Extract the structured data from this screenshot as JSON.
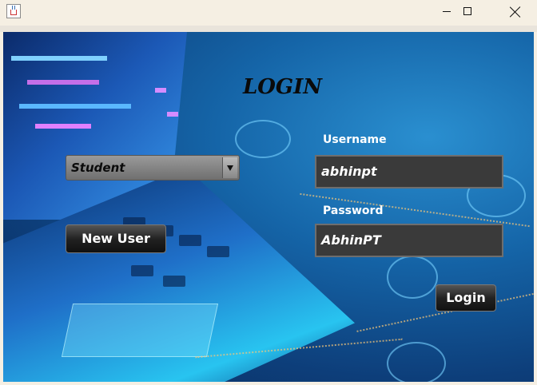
{
  "window": {
    "minimize_icon": "minimize-icon",
    "maximize_icon": "maximize-icon",
    "close_icon": "close-icon",
    "app_icon": "java-icon"
  },
  "form": {
    "title": "LOGIN",
    "role_selected": "Student",
    "username_label": "Username",
    "username_value": "abhinpt",
    "password_label": "Password",
    "password_value": "AbhinPT",
    "new_user_label": "New User",
    "login_label": "Login"
  },
  "colors": {
    "field_bg": "#3a3a3a",
    "button_bg": "#1a1a1a",
    "title_color": "#0a0a0a"
  }
}
